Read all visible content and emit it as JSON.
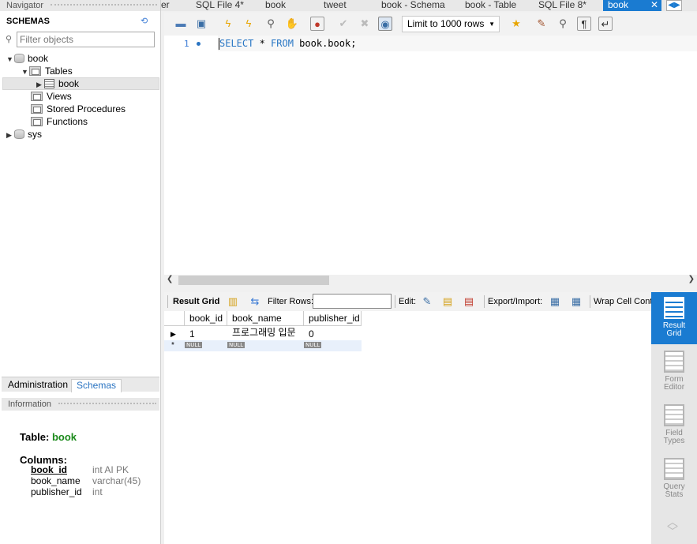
{
  "navigator": {
    "title": "Navigator",
    "schemas_header": "SCHEMAS",
    "filter_placeholder": "Filter objects",
    "tree": {
      "schema_book": "book",
      "tables": "Tables",
      "table_book": "book",
      "views": "Views",
      "stored_procedures": "Stored Procedures",
      "functions": "Functions",
      "schema_sys": "sys"
    },
    "bottom_tabs": [
      "Administration",
      "Schemas"
    ],
    "active_bottom_tab": "Schemas"
  },
  "information": {
    "title": "Information",
    "table_label": "Table:",
    "table_name": "book",
    "columns_label": "Columns:",
    "columns": [
      {
        "name": "book_id",
        "type": "int AI PK"
      },
      {
        "name": "book_name",
        "type": "varchar(45)"
      },
      {
        "name": "publisher_id",
        "type": "int"
      }
    ]
  },
  "tabs": [
    {
      "label": "er"
    },
    {
      "label": "SQL File 4*"
    },
    {
      "label": "book"
    },
    {
      "label": "tweet"
    },
    {
      "label": "book - Schema"
    },
    {
      "label": "book - Table"
    },
    {
      "label": "SQL File 8*"
    },
    {
      "label": "book"
    }
  ],
  "active_tab": "book",
  "sql_toolbar": {
    "limit": "Limit to 1000 rows"
  },
  "editor": {
    "line_number": "1",
    "keyword_select": "SELECT",
    "star": " * ",
    "keyword_from": "FROM",
    "rest": " book.book;"
  },
  "result_toolbar": {
    "result_grid": "Result Grid",
    "filter_rows": "Filter Rows:",
    "edit": "Edit:",
    "export_import": "Export/Import:",
    "wrap": "Wrap Cell Conte"
  },
  "result_grid": {
    "columns": [
      "book_id",
      "book_name",
      "publisher_id"
    ],
    "rows": [
      [
        "1",
        "프로그래밍 입문",
        "0"
      ]
    ],
    "null_label": "NULL"
  },
  "side_panel": [
    {
      "label_1": "Result",
      "label_2": "Grid",
      "active": true
    },
    {
      "label_1": "Form",
      "label_2": "Editor",
      "active": false
    },
    {
      "label_1": "Field",
      "label_2": "Types",
      "active": false
    },
    {
      "label_1": "Query",
      "label_2": "Stats",
      "active": false
    }
  ],
  "colors": {
    "accent": "#1a7bd1",
    "keyword": "#2876c4",
    "table_name": "#1b8a1b"
  }
}
